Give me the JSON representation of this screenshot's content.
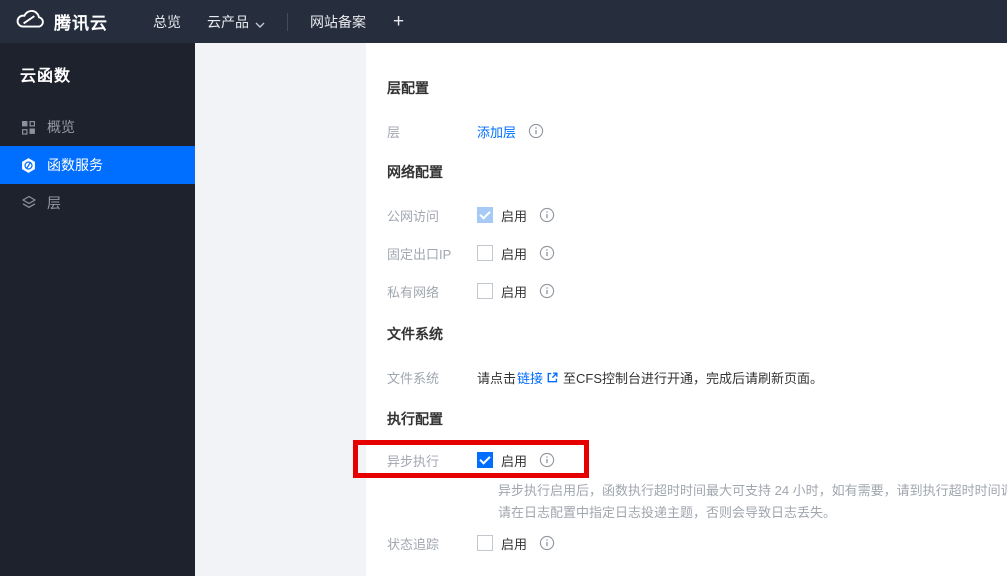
{
  "colors": {
    "accent_blue": "#006eff",
    "annotation_red": "#e60000",
    "topbar_bg": "#262e3d",
    "sidebar_bg": "#1e222c"
  },
  "topbar": {
    "logo_title": "腾讯云",
    "nav_overview": "总览",
    "nav_products": "云产品",
    "nav_icp": "网站备案",
    "nav_add": "+"
  },
  "sidebar": {
    "title": "云函数",
    "item_overview": "概览",
    "item_functions": "函数服务",
    "item_layers": "层"
  },
  "form": {
    "section_layer": {
      "title": "层配置",
      "label": "层",
      "add_layer_link": "添加层"
    },
    "section_network": {
      "title": "网络配置",
      "rows": [
        {
          "label": "公网访问",
          "state": "checked_disabled",
          "value": "启用"
        },
        {
          "label": "固定出口IP",
          "state": "unchecked",
          "value": "启用"
        },
        {
          "label": "私有网络",
          "state": "unchecked",
          "value": "启用"
        }
      ]
    },
    "section_filesystem": {
      "title": "文件系统",
      "label": "文件系统",
      "text_before": "请点击",
      "link": "链接",
      "text_after": "至CFS控制台进行开通，完成后请刷新页面。"
    },
    "section_execution": {
      "title": "执行配置",
      "async_label": "异步执行",
      "async_state": "checked",
      "async_value": "启用",
      "helper_line1": "异步执行启用后，函数执行超时时间最大可支持 24 小时，如有需要，请到执行超时时间调整。",
      "helper_line2": "请在日志配置中指定日志投递主题，否则会导致日志丢失。",
      "trace_label": "状态追踪",
      "trace_state": "unchecked",
      "trace_value": "启用"
    }
  }
}
